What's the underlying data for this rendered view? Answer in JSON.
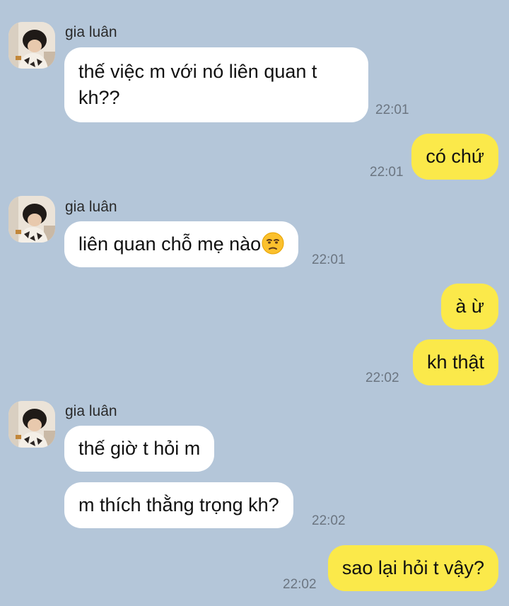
{
  "chat": {
    "sender_name": "gia luân",
    "messages": [
      {
        "text": "thế việc m với nó liên quan t kh??",
        "time": "22:01"
      },
      {
        "text": "có chứ",
        "time": "22:01"
      },
      {
        "text": "liên quan chỗ mẹ nào",
        "time": "22:01",
        "emoji": "unamused-face-icon"
      },
      {
        "text": "à ừ"
      },
      {
        "text": "kh thật",
        "time": "22:02"
      },
      {
        "text": "thế giờ t hỏi m"
      },
      {
        "text": "m thích thằng trọng kh?",
        "time": "22:02"
      },
      {
        "text": "sao lại hỏi t vậy?",
        "time": "22:02"
      }
    ]
  },
  "colors": {
    "background": "#b4c6d9",
    "incoming_bubble": "#ffffff",
    "outgoing_bubble": "#fbe94a",
    "timestamp": "#6b7581"
  }
}
